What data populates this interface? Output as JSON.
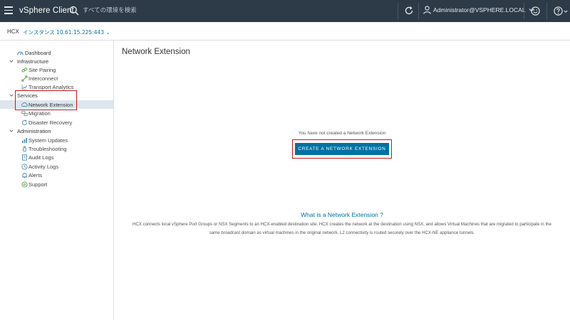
{
  "header": {
    "brand": "vSphere Client",
    "search_placeholder": "すべての環境を検索",
    "user_label": "Administrator@VSPHERE.LOCAL"
  },
  "subheader": {
    "app": "HCX",
    "instance": "インスタンス 10.61.15.225:443 ⌄"
  },
  "sidebar": {
    "dashboard": "Dashboard",
    "infrastructure": {
      "label": "Infrastructure",
      "items": [
        "Site Pairing",
        "Interconnect",
        "Transport Analytics"
      ]
    },
    "services": {
      "label": "Services",
      "items": [
        "Network Extension",
        "Migration",
        "Disaster Recovery"
      ]
    },
    "administration": {
      "label": "Administration",
      "items": [
        "System Updates",
        "Troubleshooting",
        "Audit Logs",
        "Activity Logs",
        "Alerts",
        "Support"
      ]
    },
    "active_item": "Network Extension"
  },
  "main": {
    "title": "Network Extension",
    "empty_message": "You have not created a Network Extension",
    "create_button": "CREATE A NETWORK EXTENSION",
    "info_title": "What is a Network Extension ?",
    "info_text": "HCX connects local vSphere Port Groups or NSX Segments to an HCX-enabled destination site. HCX creates the network at the destination using NSX, and allows Virtual Machines that are migrated to participate in the same broadcast domain as virtual machines in the original network. L2 connectivity is routed securely over the HCX-NE appliance tunnels."
  },
  "colors": {
    "header_bg": "#2d3a47",
    "accent": "#0072a3",
    "highlight": "#c4171c",
    "active_row": "#dde6ec"
  }
}
